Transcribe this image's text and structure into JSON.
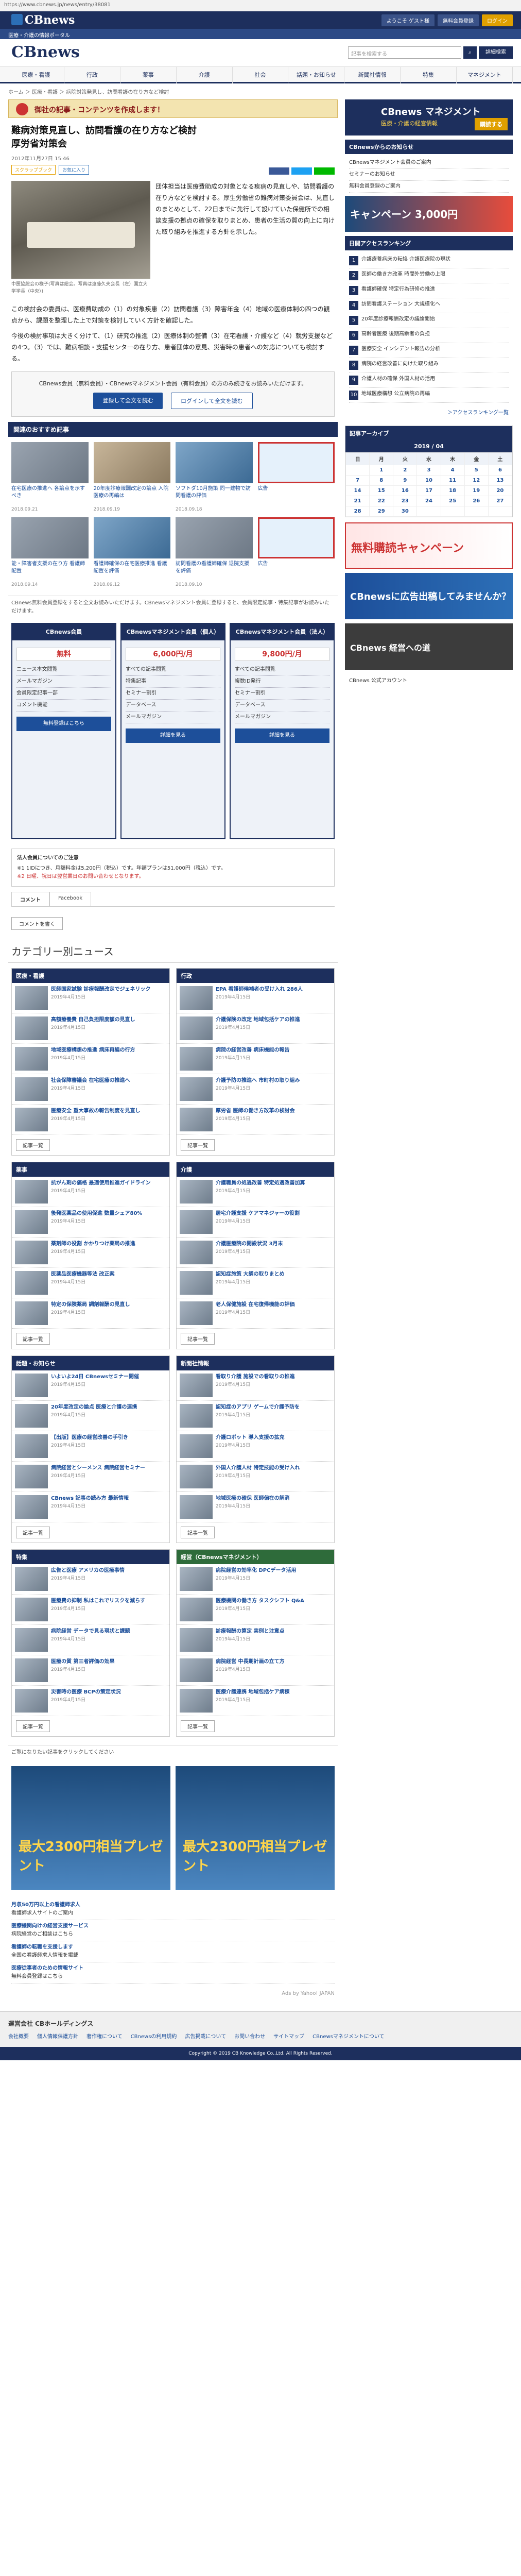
{
  "browser": {
    "url": "https://www.cbnews.jp/news/entry/38081"
  },
  "topbar": {
    "logo": "CBnews",
    "links": [
      "ようこそ ゲスト様",
      "無料会員登録",
      "ログイン"
    ]
  },
  "subnav": {
    "text": "医療・介護の情報ポータル"
  },
  "header": {
    "brand": "CBnews",
    "search_placeholder": "記事を検索する",
    "search_icon": "search-icon",
    "detail_button": "詳細検索"
  },
  "mainnav": [
    "医療・看護",
    "行政",
    "薬事",
    "介護",
    "社会",
    "話題・お知らせ",
    "新聞社情報",
    "特集",
    "マネジメント"
  ],
  "breadcrumb": "ホーム ＞ 医療・看護 ＞ 病院対策発見し、訪問看護の在り方など検討",
  "promo": {
    "text": "御社の記事・コンテンツを作成します！"
  },
  "article": {
    "title": "難病対策見直し、訪問看護の在り方など検討",
    "subtitle": "厚労省対策会",
    "date": "2012年11月27日 15:46",
    "tags": [
      "スクラップブック",
      "お気に入り"
    ],
    "photo_caption": "中医協総会の様子(写真は総会。写真は遠藤久夫会長（左）国立大学学長（中央）)",
    "lead": "団体担当は医療費助成の対象となる疾病の見直しや、訪問看護の在り方などを検討する。厚生労働省の難病対策委員会は、見直しのまとめとして、22日までに先行して設けていた保健所での相談支援の拠点の確保を取りまとめ、患者の生活の質の向上に向けた取り組みを推進する方針を示した。",
    "body1": "この検討会の委員は、医療費助成の（1）の対象疾患（2）訪問看護（3）障害年金（4）地域の医療体制の四つの観点から、課題を整理した上で対策を検討していく方針を確認した。",
    "body2": "今後の検討事項は大きく分けて、（1）研究の推進（2）医療体制の整備（3）在宅看護・介護など（4）就労支援などの4つ。（3）では、難病相談・支援センターの在り方、患者団体の意見、災害時の患者への対応についても検討する。",
    "paywall_msg": "CBnews会員（無料会員）・CBnewsマネジメント会員（有料会員）の方のみ続きをお読みいただけます。",
    "paywall_btn1": "登録して全文を読む",
    "paywall_btn2": "ログインして全文を読む"
  },
  "recommend": {
    "title": "関連のおすすめ記事",
    "items": [
      {
        "t": "在宅医療の推進へ 各論点を示すべき",
        "d": "2018.09.21"
      },
      {
        "t": "20年度診療報酬改定の論点 入院医療の再編は",
        "d": "2018.09.19"
      },
      {
        "t": "ソフトダ10月施策 同一建物で訪問看護の評価",
        "d": "2018.09.18"
      },
      {
        "t": "広告",
        "d": ""
      },
      {
        "t": "能・障害者支援の在り方 看護師配置",
        "d": "2018.09.14"
      },
      {
        "t": "看護師確保の在宅医療推進 看護配置を評価",
        "d": "2018.09.12"
      },
      {
        "t": "訪問看護の看護師確保 退院支援を評価",
        "d": "2018.09.10"
      },
      {
        "t": "広告",
        "d": ""
      }
    ]
  },
  "note_text": "CBnews無料会員登録をすると全文お読みいただけます。CBnewsマネジメント会員に登録すると、会員限定記事・特集記事がお読みいただけます。",
  "plans": [
    {
      "head": "CBnews会員",
      "price": "無料",
      "features": [
        "ニュース本文閲覧",
        "メールマガジン",
        "会員限定記事一部",
        "コメント機能"
      ],
      "button": "無料登録はこちら"
    },
    {
      "head": "CBnewsマネジメント会員（個人）",
      "price": "6,000円/月",
      "features": [
        "すべての記事閲覧",
        "特集記事",
        "セミナー割引",
        "データベース",
        "メールマガジン"
      ],
      "button": "詳細を見る"
    },
    {
      "head": "CBnewsマネジメント会員（法人）",
      "price": "9,800円/月",
      "features": [
        "すべての記事閲覧",
        "複数ID発行",
        "セミナー割引",
        "データベース",
        "メールマガジン"
      ],
      "button": "詳細を見る"
    }
  ],
  "guide": {
    "head": "法人会員についてのご注意",
    "line1": "※1 1IDにつき、月額料金は5,200円（税込）です。年額プランは51,000円（税込）です。",
    "line2": "※2 日曜、祝日は翌営業日のお問い合わせとなります。"
  },
  "comment_tabs": [
    "コメント",
    "Facebook"
  ],
  "comment_button": "コメントを書く",
  "category_title": "カテゴリー別ニュース",
  "categories": [
    {
      "head": "医療・看護",
      "items": [
        {
          "t": "医師国家試験 診療報酬改定でジェネリック",
          "d": "2019年4月15日"
        },
        {
          "t": "高額療養費 自己負担限度額の見直し",
          "d": "2019年4月15日"
        },
        {
          "t": "地域医療構想の推進 病床再編の行方",
          "d": "2019年4月15日"
        },
        {
          "t": "社会保障審議会 在宅医療の推進へ",
          "d": "2019年4月15日"
        },
        {
          "t": "医療安全 重大事故の報告制度を見直し",
          "d": "2019年4月15日"
        }
      ]
    },
    {
      "head": "行政",
      "items": [
        {
          "t": "EPA 看護師候補者の受け入れ 286人",
          "d": "2019年4月15日"
        },
        {
          "t": "介護保険の改定 地域包括ケアの推進",
          "d": "2019年4月15日"
        },
        {
          "t": "病院の経営改善 病床機能の報告",
          "d": "2019年4月15日"
        },
        {
          "t": "介護予防の推進へ 市町村の取り組み",
          "d": "2019年4月15日"
        },
        {
          "t": "厚労省 医師の働き方改革の検討会",
          "d": "2019年4月15日"
        }
      ]
    },
    {
      "head": "薬事",
      "items": [
        {
          "t": "抗がん剤の価格 最適使用推進ガイドライン",
          "d": "2019年4月15日"
        },
        {
          "t": "後発医薬品の使用促進 数量シェア80%",
          "d": "2019年4月15日"
        },
        {
          "t": "薬剤師の役割 かかりつけ薬局の推進",
          "d": "2019年4月15日"
        },
        {
          "t": "医薬品医療機器等法 改正案",
          "d": "2019年4月15日"
        },
        {
          "t": "特定の保険薬局 調剤報酬の見直し",
          "d": "2019年4月15日"
        }
      ]
    },
    {
      "head": "介護",
      "items": [
        {
          "t": "介護職員の処遇改善 特定処遇改善加算",
          "d": "2019年4月15日"
        },
        {
          "t": "居宅介護支援 ケアマネジャーの役割",
          "d": "2019年4月15日"
        },
        {
          "t": "介護医療院の開設状況 3月末",
          "d": "2019年4月15日"
        },
        {
          "t": "認知症施策 大綱の取りまとめ",
          "d": "2019年4月15日"
        },
        {
          "t": "老人保健施設 在宅復帰機能の評価",
          "d": "2019年4月15日"
        }
      ]
    },
    {
      "head": "話題・お知らせ",
      "items": [
        {
          "t": "いよいよ24日 CBnewsセミナー開催",
          "d": "2019年4月15日"
        },
        {
          "t": "20年度改定の論点 医療と介護の連携",
          "d": "2019年4月15日"
        },
        {
          "t": "【出版】医療の経営改善の手引き",
          "d": "2019年4月15日"
        },
        {
          "t": "病院経営とシーメンス 病院経営セミナー",
          "d": "2019年4月15日"
        },
        {
          "t": "CBnews 記事の読み方 最新情報",
          "d": "2019年4月15日"
        }
      ]
    },
    {
      "head": "新聞社情報",
      "items": [
        {
          "t": "看取り介護 施設での看取りの推進",
          "d": "2019年4月15日"
        },
        {
          "t": "認知症のアプリ ゲームで介護予防を",
          "d": "2019年4月15日"
        },
        {
          "t": "介護ロボット 導入支援の拡充",
          "d": "2019年4月15日"
        },
        {
          "t": "外国人介護人材 特定技能の受け入れ",
          "d": "2019年4月15日"
        },
        {
          "t": "地域医療の確保 医師偏在の解消",
          "d": "2019年4月15日"
        }
      ]
    },
    {
      "head": "特集",
      "items": [
        {
          "t": "広告と医療 アメリカの医療事情",
          "d": "2019年4月15日"
        },
        {
          "t": "医療費の抑制 私はこれでリスクを減らす",
          "d": "2019年4月15日"
        },
        {
          "t": "病院経営 データで見る現状と課題",
          "d": "2019年4月15日"
        },
        {
          "t": "医療の質 第三者評価の効果",
          "d": "2019年4月15日"
        },
        {
          "t": "災害時の医療 BCPの策定状況",
          "d": "2019年4月15日"
        }
      ]
    },
    {
      "head": "経営（CBnewsマネジメント）",
      "items": [
        {
          "t": "病院経営の効率化 DPCデータ活用",
          "d": "2019年4月15日"
        },
        {
          "t": "医療機関の働き方 タスクシフト Q&A",
          "d": "2019年4月15日"
        },
        {
          "t": "診療報酬の算定 実例と注意点",
          "d": "2019年4月15日"
        },
        {
          "t": "病院経営 中長期計画の立て方",
          "d": "2019年4月15日"
        },
        {
          "t": "医療介護連携 地域包括ケア病棟",
          "d": "2019年4月15日"
        }
      ]
    }
  ],
  "more_button": "記事一覧",
  "adbanner_text": "最大2300円相当プレゼント",
  "adbanner_note": "ご覧になりたい記事をクリックしてください",
  "textads": [
    {
      "t": "月収50万円以上の看護師求人",
      "s": "看護師求人サイトのご案内"
    },
    {
      "t": "医療機関向けの経営支援サービス",
      "s": "病院経営のご相談はこちら"
    },
    {
      "t": "看護師の転職を支援します",
      "s": "全国の看護師求人情報を掲載"
    },
    {
      "t": "医療従事者のための情報サイト",
      "s": "無料会員登録はこちら"
    }
  ],
  "ads_by": "Ads by Yahoo! JAPAN",
  "sidebar": {
    "banner1": {
      "s1": "CBnews マネジメント",
      "s2": "医療・介護の経営情報",
      "s3": "購読する"
    },
    "notice_head": "CBnewsからのお知らせ",
    "notices": [
      "CBnewsマネジメント会員のご案内",
      "セミナーのお知らせ",
      "無料会員登録のご案内"
    ],
    "banner2": {
      "s1": "キャンペーン 3,000円"
    },
    "rank_head": "日間アクセスランキング",
    "ranks": [
      "介護療養病床の転換 介護医療院の現状",
      "医師の働き方改革 時間外労働の上限",
      "看護師確保 特定行為研修の推進",
      "訪問看護ステーション 大規模化へ",
      "20年度診療報酬改定の議論開始",
      "高齢者医療 後期高齢者の負担",
      "医療安全 インシデント報告の分析",
      "病院の経営改善に向けた取り組み",
      "介護人材の確保 外国人材の活用",
      "地域医療構想 公立病院の再編"
    ],
    "rank_more": "＞アクセスランキング一覧",
    "calendar": {
      "head": "記事アーカイブ",
      "month": "2019 / 04",
      "days": [
        "日",
        "月",
        "火",
        "水",
        "木",
        "金",
        "土"
      ],
      "weeks": [
        [
          "",
          "1",
          "2",
          "3",
          "4",
          "5",
          "6"
        ],
        [
          "7",
          "8",
          "9",
          "10",
          "11",
          "12",
          "13"
        ],
        [
          "14",
          "15",
          "16",
          "17",
          "18",
          "19",
          "20"
        ],
        [
          "21",
          "22",
          "23",
          "24",
          "25",
          "26",
          "27"
        ],
        [
          "28",
          "29",
          "30",
          "",
          "",
          "",
          ""
        ]
      ]
    },
    "banner3": {
      "s1": "無料購読キャンペーン"
    },
    "banner4": {
      "s1": "CBnewsに広告出稿してみませんか？"
    },
    "banner5": {
      "s1": "CBnews 経営への道"
    },
    "twitter": "CBnews 公式アカウント"
  },
  "footer": {
    "label": "運営会社 CBホールディングス",
    "links": [
      "会社概要",
      "個人情報保護方針",
      "著作権について",
      "CBnewsの利用規約",
      "広告掲載について",
      "お問い合わせ",
      "サイトマップ",
      "CBnewsマネジメントについて"
    ],
    "copyright": "Copyright © 2019 CB Knowledge Co.,Ltd. All Rights Reserved."
  }
}
